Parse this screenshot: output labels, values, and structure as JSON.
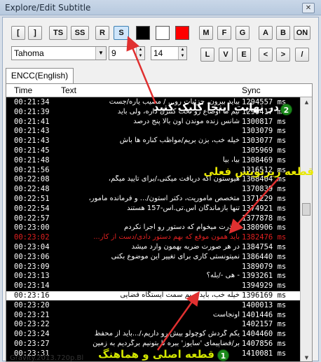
{
  "window": {
    "title": "Explore/Edit Subtitle",
    "close_label": "✕"
  },
  "toolbar": {
    "buttons": [
      {
        "label": "["
      },
      {
        "label": "]"
      },
      {
        "label": "TS"
      },
      {
        "label": "SS"
      },
      {
        "label": "R"
      },
      {
        "label": "S"
      },
      {
        "label": "M"
      },
      {
        "label": "F"
      },
      {
        "label": "G"
      },
      {
        "label": "A"
      },
      {
        "label": "B"
      },
      {
        "label": "ON"
      },
      {
        "label": "L"
      },
      {
        "label": "V"
      },
      {
        "label": "E"
      },
      {
        "label": "<"
      },
      {
        "label": ">"
      },
      {
        "label": "/"
      }
    ],
    "colors": {
      "black": "#000000",
      "white": "#ffffff",
      "red": "#ff0000"
    },
    "font_name": "Tahoma",
    "size_a": "9",
    "size_b": "14"
  },
  "tab": {
    "label": "ENCC(English)"
  },
  "grid": {
    "headers": {
      "time": "Time",
      "text": "Text",
      "sync": "Sync"
    },
    "rows": [
      {
        "time": "00:21:34",
        "text": "بیاید بیرون، جزئیات رو... / مصیب یاره/جست",
        "sync": "1294557 ms"
      },
      {
        "time": "00:21:39",
        "text": "تیم ما اوضاع رو تحت کنترل داره، ولی باید",
        "sync": "1299417 ms"
      },
      {
        "time": "00:21:41",
        "text": "شانس زنده موندن اون بالا پنج درصد",
        "sync": "1300817 ms"
      },
      {
        "time": "00:21:43",
        "text": "",
        "sync": "1303079 ms"
      },
      {
        "time": "00:21:43",
        "text": "خیله خب، بزن بریم/مواظب کناره ها باش",
        "sync": "1303077 ms"
      },
      {
        "time": "00:21:45",
        "text": "",
        "sync": "1305969 ms"
      },
      {
        "time": "00:21:48",
        "text": "بیا، بیا",
        "sync": "1308469 ms"
      },
      {
        "time": "00:21:56",
        "text": "",
        "sync": "1316512 ms"
      },
      {
        "time": "00:22:08",
        "text": "هیوستون اگه دریافت میکنی،/برای تأیید میگم،",
        "sync": "1368404 ms"
      },
      {
        "time": "00:22:48",
        "text": "",
        "sync": "1370839 ms"
      },
      {
        "time": "00:22:51",
        "text": "متخصص مأموریت، دکتر استون/... و فرمانده مأمور،",
        "sync": "1371229 ms"
      },
      {
        "time": "00:22:54",
        "text": "تنها بازماندگان اس.تی.اس-157 هستند",
        "sync": "1374921 ms"
      },
      {
        "time": "00:22:57",
        "text": "",
        "sync": "1377878 ms"
      },
      {
        "time": "00:23:00",
        "text": "معذرت میخوام که دستور رو اجرا نکردم",
        "sync": "1380906 ms"
      },
      {
        "time": "00:23:02",
        "text": "باید همون موقع که بهم دستور دادی/دست از کار...",
        "sync": "1382476 ms",
        "active": true
      },
      {
        "time": "00:23:04",
        "text": "در هر صورت ضربه بهمون وارد میشد",
        "sync": "1384754 ms"
      },
      {
        "time": "00:23:06",
        "text": "نمیتونستی کاری برای تغییر این موضوع بکنی",
        "sync": "1386440 ms"
      },
      {
        "time": "00:23:09",
        "text": "",
        "sync": "1389079 ms"
      },
      {
        "time": "00:23:13",
        "text": "- هی -/بله؟",
        "sync": "1393261 ms"
      },
      {
        "time": "00:23:14",
        "text": "",
        "sync": "1394929 ms"
      },
      {
        "time": "00:23:16",
        "text": "خیله خب، باید بریم سمت ایستگاه فضایی",
        "sync": "1396169 ms",
        "selected": true
      },
      {
        "time": "00:23:20",
        "text": "",
        "sync": "1400013 ms"
      },
      {
        "time": "00:23:21",
        "text": "اونجاست",
        "sync": "1401446 ms"
      },
      {
        "time": "00:23:22",
        "text": "",
        "sync": "1402157 ms"
      },
      {
        "time": "00:23:24",
        "text": "یکم گردش کوچولو بیش رو داریم،/...باید از محفظ",
        "sync": "1404460 ms"
      },
      {
        "time": "00:23:27",
        "text": "بر/فضاپیمای 'سایوز' ببره تا بتونیم برگردیم به زمین",
        "sync": "1407856 ms"
      },
      {
        "time": "00:23:31",
        "text": "",
        "sync": "1410081 ms"
      }
    ]
  },
  "status": {
    "text": "Gravity.2013.720p.Bl"
  },
  "annotations": {
    "one": {
      "number": "1",
      "text": "قطعه اصلی و هماهنگ",
      "color": "#d4e800"
    },
    "two": {
      "number": "2",
      "text": "در نهایت اینجا کلیک کنید",
      "color": "#ffffff"
    },
    "three": {
      "text": "قطعه زیرنویس فعلی",
      "color": "#e8e800"
    },
    "arrow_color": "#e03030"
  }
}
